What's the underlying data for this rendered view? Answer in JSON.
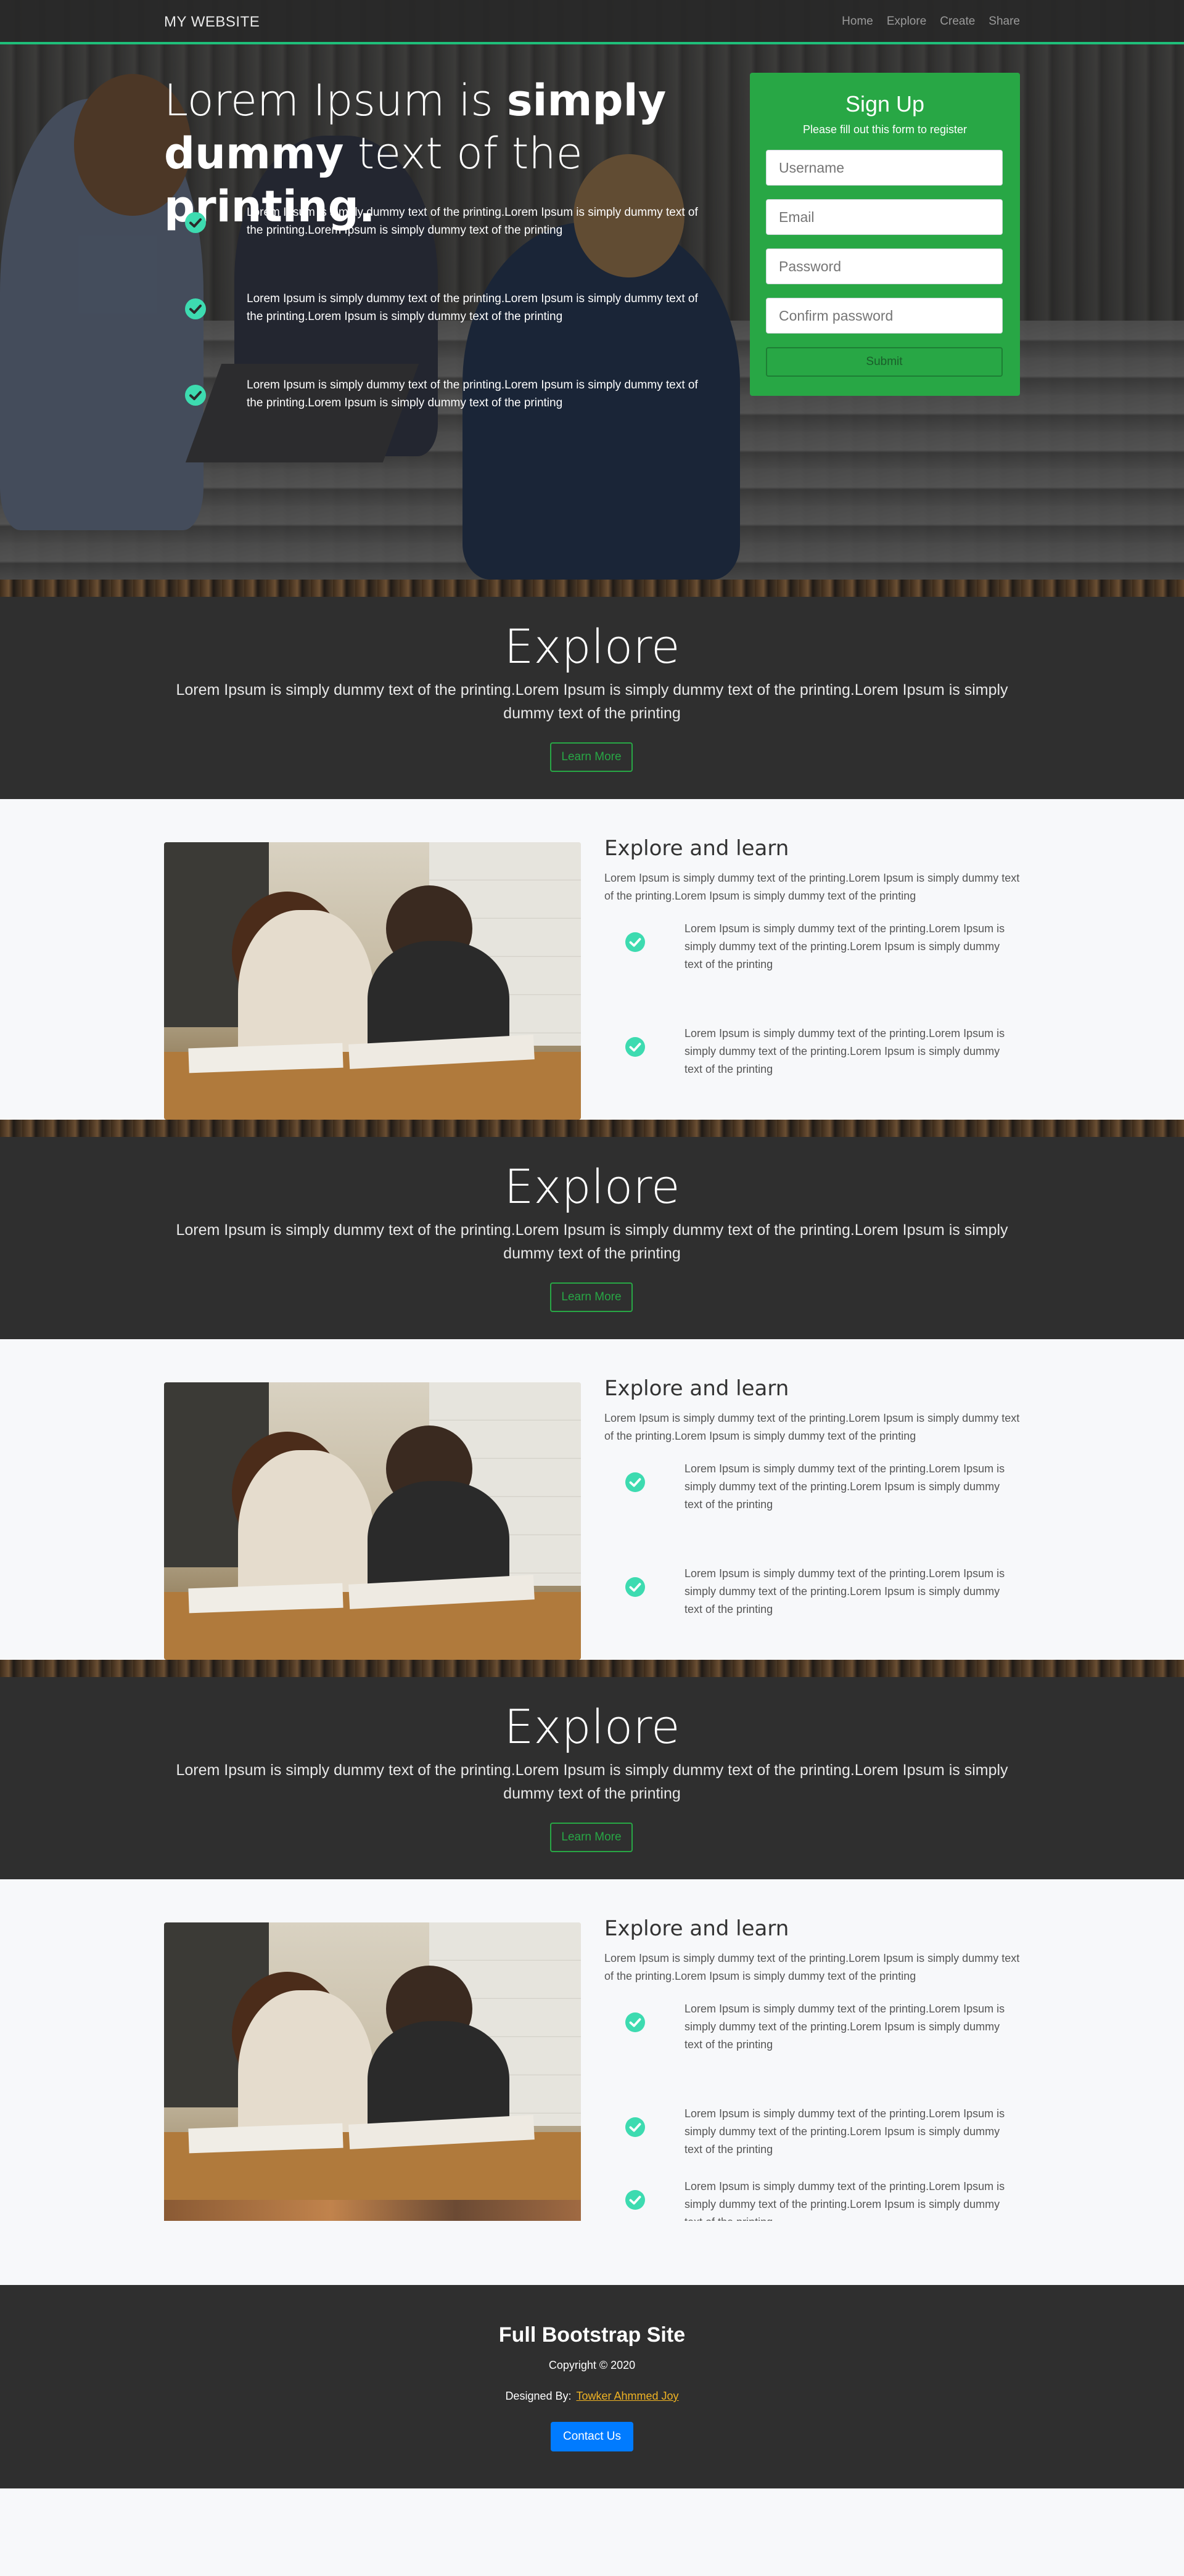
{
  "nav": {
    "brand": "MY WEBSITE",
    "links": [
      "Home",
      "Explore",
      "Create",
      "Share"
    ]
  },
  "hero": {
    "title_part1": "Lorem Ipsum is ",
    "title_bold1": "simply",
    "title_bold2": "dummy",
    "title_part2": " text of the ",
    "title_bold3": "printing.",
    "items": [
      "Lorem Ipsum is simply dummy text of the printing.Lorem Ipsum is simply dummy text of the printing.Lorem Ipsum is simply dummy text of the printing",
      "Lorem Ipsum is simply dummy text of the printing.Lorem Ipsum is simply dummy text of the printing.Lorem Ipsum is simply dummy text of the printing",
      "Lorem Ipsum is simply dummy text of the printing.Lorem Ipsum is simply dummy text of the printing.Lorem Ipsum is simply dummy text of the printing"
    ]
  },
  "signup": {
    "title": "Sign Up",
    "subtitle": "Please fill out this form to register",
    "username_placeholder": "Username",
    "email_placeholder": "Email",
    "password_placeholder": "Password",
    "confirm_placeholder": "Confirm password",
    "submit_label": "Submit"
  },
  "explore": {
    "title": "Explore",
    "desc": "Lorem Ipsum is simply dummy text of the printing.Lorem Ipsum is simply dummy text of the printing.Lorem Ipsum is simply dummy text of the printing",
    "button": "Learn More"
  },
  "section": {
    "title": "Explore and learn",
    "intro": "Lorem Ipsum is simply dummy text of the printing.Lorem Ipsum is simply dummy text of the printing.Lorem Ipsum is simply dummy text of the printing",
    "feature": "Lorem Ipsum is simply dummy text of the printing.Lorem Ipsum is simply dummy text of the printing.Lorem Ipsum is simply dummy text of the printing"
  },
  "footer": {
    "title": "Full Bootstrap Site",
    "copyright": "Copyright © 2020",
    "designed_by_label": "Designed By:",
    "designer": "Towker Ahmmed Joy",
    "contact_button": "Contact Us"
  },
  "colors": {
    "accent_green": "#28a745",
    "check_teal": "#3ddbb0",
    "dark_bg": "#2f2f2f",
    "footer_link": "#f0b323",
    "primary_blue": "#007bff"
  }
}
